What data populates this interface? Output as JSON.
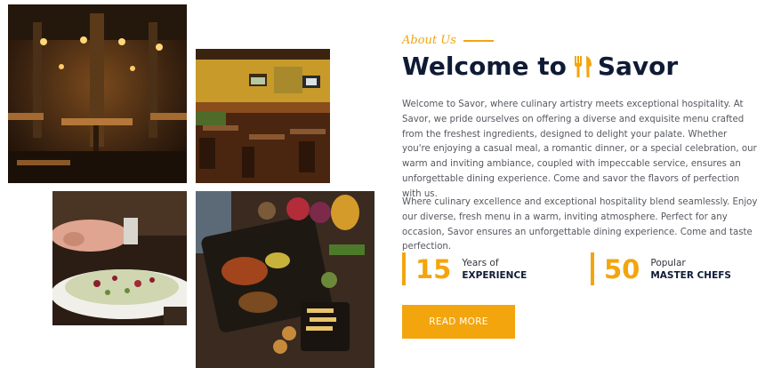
{
  "about": {
    "label": "About Us"
  },
  "welcome": {
    "prefix": "Welcome to",
    "brand": "Savor"
  },
  "paragraphs": {
    "first": "Welcome to Savor, where culinary artistry meets exceptional hospitality. At Savor, we pride ourselves on offering a diverse and exquisite menu crafted from the freshest ingredients, designed to delight your palate. Whether you're enjoying a casual meal, a romantic dinner, or a special celebration, our warm and inviting ambiance, coupled with impeccable service, ensures an unforgettable dining experience. Come and savor the flavors of perfection with us.",
    "second": "Where culinary excellence and exceptional hospitality blend seamlessly. Enjoy our diverse, fresh menu in a warm, inviting atmosphere. Perfect for any occasion, Savor ensures an unforgettable dining experience. Come and taste perfection."
  },
  "stats": [
    {
      "number": "15",
      "label_top": "Years of",
      "label_bottom": "EXPERIENCE"
    },
    {
      "number": "50",
      "label_top": "Popular",
      "label_bottom": "MASTER CHEFS"
    }
  ],
  "button": {
    "label": "READ MORE"
  },
  "colors": {
    "accent": "#f3a50e",
    "heading": "#0f1b35",
    "body_text": "#55585f"
  },
  "icons": [
    "utensils-icon"
  ]
}
